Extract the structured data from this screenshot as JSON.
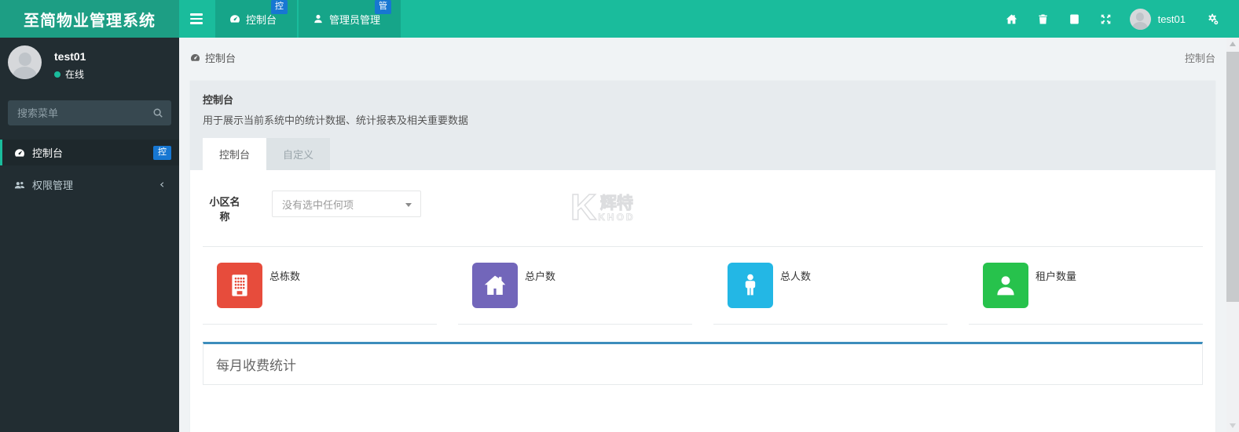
{
  "navbar": {
    "logo": "至简物业管理系统",
    "tabs": [
      {
        "label": "控制台",
        "badge": "控",
        "icon": "dashboard-icon"
      },
      {
        "label": "管理员管理",
        "badge": "管",
        "icon": "user-icon"
      }
    ],
    "right_icons": [
      "home-icon",
      "trash-icon",
      "log-icon",
      "expand-icon",
      "gears-icon"
    ],
    "username": "test01"
  },
  "sidebar": {
    "username": "test01",
    "status": "在线",
    "search_placeholder": "搜索菜单",
    "items": [
      {
        "label": "控制台",
        "badge": "控",
        "icon": "dashboard-icon",
        "active": true
      },
      {
        "label": "权限管理",
        "icon": "users-icon",
        "active": false
      }
    ]
  },
  "breadcrumb": {
    "left": "控制台",
    "right": "控制台"
  },
  "panel": {
    "title": "控制台",
    "description": "用于展示当前系统中的统计数据、统计报表及相关重要数据",
    "tabs": [
      {
        "label": "控制台",
        "active": true
      },
      {
        "label": "自定义",
        "active": false
      }
    ]
  },
  "form": {
    "label": "小区名称",
    "select_value": "没有选中任何项"
  },
  "stats": [
    {
      "label": "总栋数",
      "color": "#e74c3c",
      "icon": "building-icon"
    },
    {
      "label": "总户数",
      "color": "#7266ba",
      "icon": "house-icon"
    },
    {
      "label": "总人数",
      "color": "#23b7e5",
      "icon": "person-icon"
    },
    {
      "label": "租户数量",
      "color": "#27c24c",
      "icon": "tenant-icon"
    }
  ],
  "chart": {
    "title": "每月收费统计"
  },
  "watermark": {
    "k": "K",
    "cn": "辉特",
    "en": "KHOD"
  },
  "colors": {
    "navbar": "#1abc9c",
    "logo_bg": "#1d9e84",
    "nav_tab_bg": "#16a78b",
    "badge_blue": "#1777d2",
    "sidebar_bg": "#222d32",
    "sidebar_active_bg": "#1e282c",
    "online_dot": "#1abc9c",
    "page_bg": "#f0f3f5",
    "panel_head_bg": "#e7ebee",
    "chart_accent": "#3c8dbc",
    "divider": "#e7eaec"
  }
}
